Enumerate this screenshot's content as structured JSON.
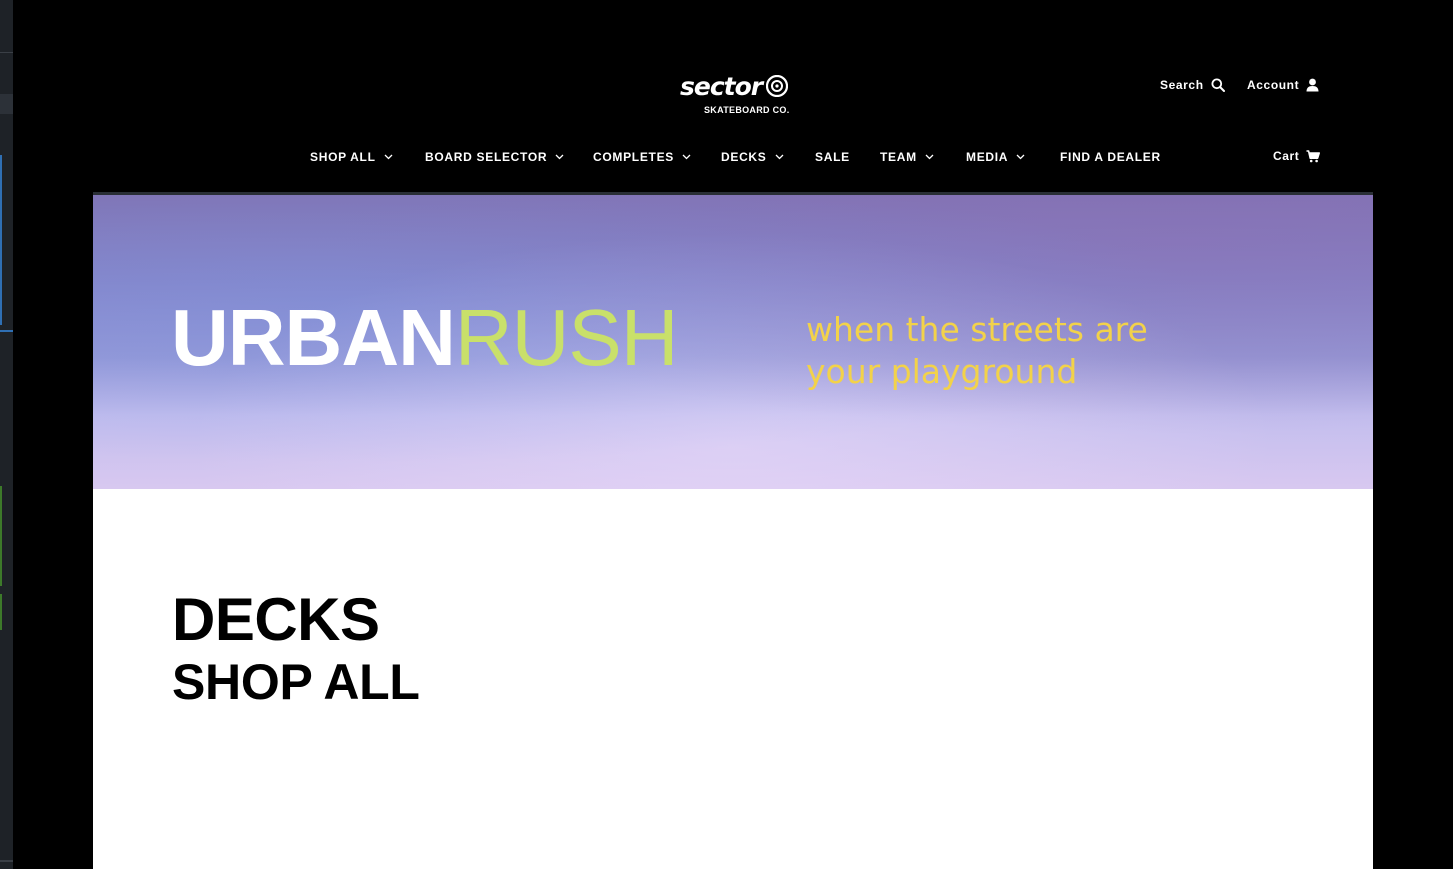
{
  "logo": {
    "wordmark": "sector",
    "tagline": "SKATEBOARD CO."
  },
  "utility": {
    "search_label": "Search",
    "account_label": "Account",
    "cart_label": "Cart"
  },
  "nav": {
    "items": [
      {
        "label": "SHOP ALL",
        "has_dropdown": true
      },
      {
        "label": "BOARD SELECTOR",
        "has_dropdown": true
      },
      {
        "label": "COMPLETES",
        "has_dropdown": true
      },
      {
        "label": "DECKS",
        "has_dropdown": true
      },
      {
        "label": "SALE",
        "has_dropdown": false
      },
      {
        "label": "TEAM",
        "has_dropdown": true
      },
      {
        "label": "MEDIA",
        "has_dropdown": true
      },
      {
        "label": "FIND A DEALER",
        "has_dropdown": false
      }
    ]
  },
  "hero": {
    "title_part1": "URBAN",
    "title_part2": "RUSH",
    "tagline": "when the streets are your playground"
  },
  "page": {
    "heading": "DECKS",
    "subheading": "SHOP ALL"
  },
  "colors": {
    "header_bg": "#000000",
    "accent_green": "#c9e06a",
    "accent_yellow": "#f2d24a",
    "hero_purple": "#8f8ad0"
  },
  "icons": {
    "search": "search-icon",
    "account": "user-icon",
    "cart": "cart-icon",
    "dropdown": "chevron-down-icon"
  }
}
